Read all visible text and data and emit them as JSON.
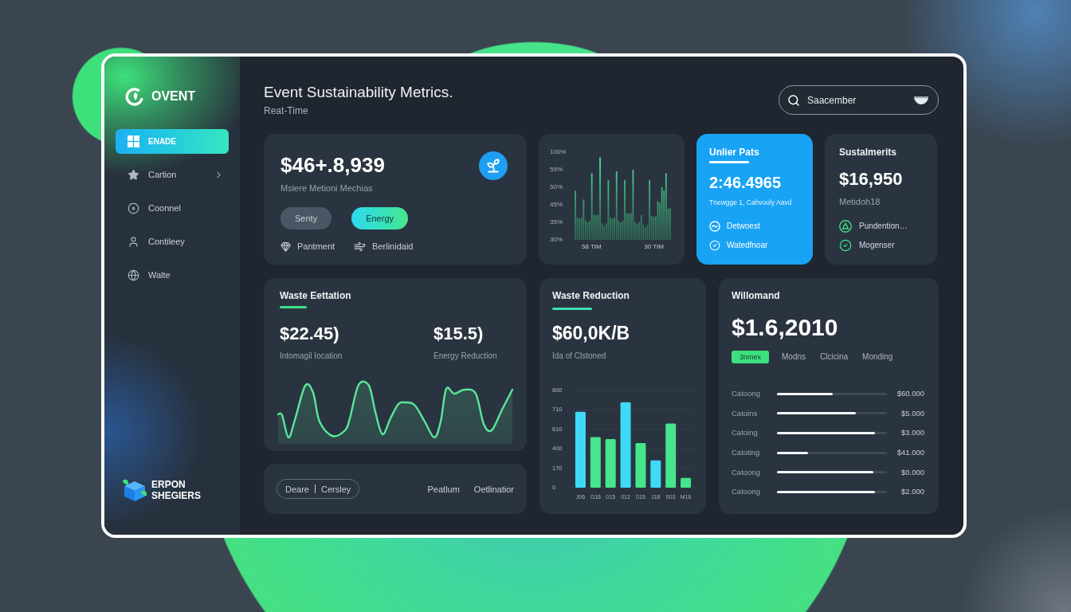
{
  "sidebar": {
    "logo": "OVENT",
    "items": [
      {
        "label": "ENADE",
        "selected": true,
        "expandable": false
      },
      {
        "label": "Cartion",
        "selected": false,
        "expandable": true
      },
      {
        "label": "Coonnel",
        "selected": false,
        "expandable": false
      },
      {
        "label": "Contileey",
        "selected": false,
        "expandable": false
      },
      {
        "label": "Walte",
        "selected": false,
        "expandable": false
      }
    ],
    "footer_logo": [
      "ERPON",
      "SHEGIERS"
    ]
  },
  "header": {
    "title": "Event Sustainability Metrics.",
    "subtitle": "Reat-Time",
    "search": {
      "placeholder": "Saacember"
    }
  },
  "summary_card": {
    "value": "$46+.8,939",
    "caption": "Msiere Metioni Mechias",
    "pills": [
      {
        "label": "Senty",
        "selected": false
      },
      {
        "label": "Energy",
        "selected": true
      }
    ],
    "links": [
      "Pantment",
      "Berlinidaid"
    ]
  },
  "trend_card": {
    "y_labels": [
      "100%",
      "55%",
      "50%",
      "45%",
      "35%",
      "30%"
    ],
    "x_labels": [
      "58 TIM",
      "30 TIM"
    ]
  },
  "highlight_card": {
    "title": "Unlier Pats",
    "value": "2:46.4965",
    "caption": "Tnewgge 1, Cahvooly Aavd",
    "items": [
      "Detwoest",
      "Watedfnoar"
    ]
  },
  "sustainment_card": {
    "title": "Sustalmerits",
    "value": "$16,950",
    "caption": "Metidoh18",
    "items": [
      "Pundention…",
      "Mogenser"
    ]
  },
  "waste_card": {
    "title": "Waste Eettation",
    "metrics": [
      {
        "value": "$22.45)",
        "label": "Intomagil Iocation"
      },
      {
        "value": "$15.5)",
        "label": "Energy Reduction"
      }
    ]
  },
  "filter_bar": {
    "segments": [
      "Deare",
      "Cersley"
    ],
    "links": [
      "Peatlum",
      "Oetlinatior"
    ]
  },
  "reduction_card": {
    "title": "Waste Reduction",
    "value": "$60,0K/B",
    "caption": "Ida of Clstoned",
    "y_labels": [
      "800",
      "710",
      "610",
      "400",
      "170",
      "0"
    ],
    "x_labels": [
      "J06",
      "G16",
      "015",
      "012",
      "015",
      "J18",
      "003",
      "M16"
    ]
  },
  "breakdown_card": {
    "title": "Willomand",
    "value": "$1.6,2010",
    "tabs": [
      {
        "label": "3nmex",
        "selected": true
      },
      {
        "label": "Modns",
        "selected": false
      },
      {
        "label": "Clcicina",
        "selected": false
      },
      {
        "label": "Monding",
        "selected": false
      }
    ],
    "rows": [
      {
        "label": "Catoong",
        "level": 0.51,
        "amount": "$60.000"
      },
      {
        "label": "Catoins",
        "level": 0.72,
        "amount": "$5.000"
      },
      {
        "label": "Catoing",
        "level": 0.89,
        "amount": "$3.000"
      },
      {
        "label": "Catoting",
        "level": 0.28,
        "amount": "$41.000"
      },
      {
        "label": "Catoong",
        "level": 0.88,
        "amount": "$0.000"
      },
      {
        "label": "Catoong",
        "level": 0.89,
        "amount": "$2.000"
      }
    ]
  }
}
